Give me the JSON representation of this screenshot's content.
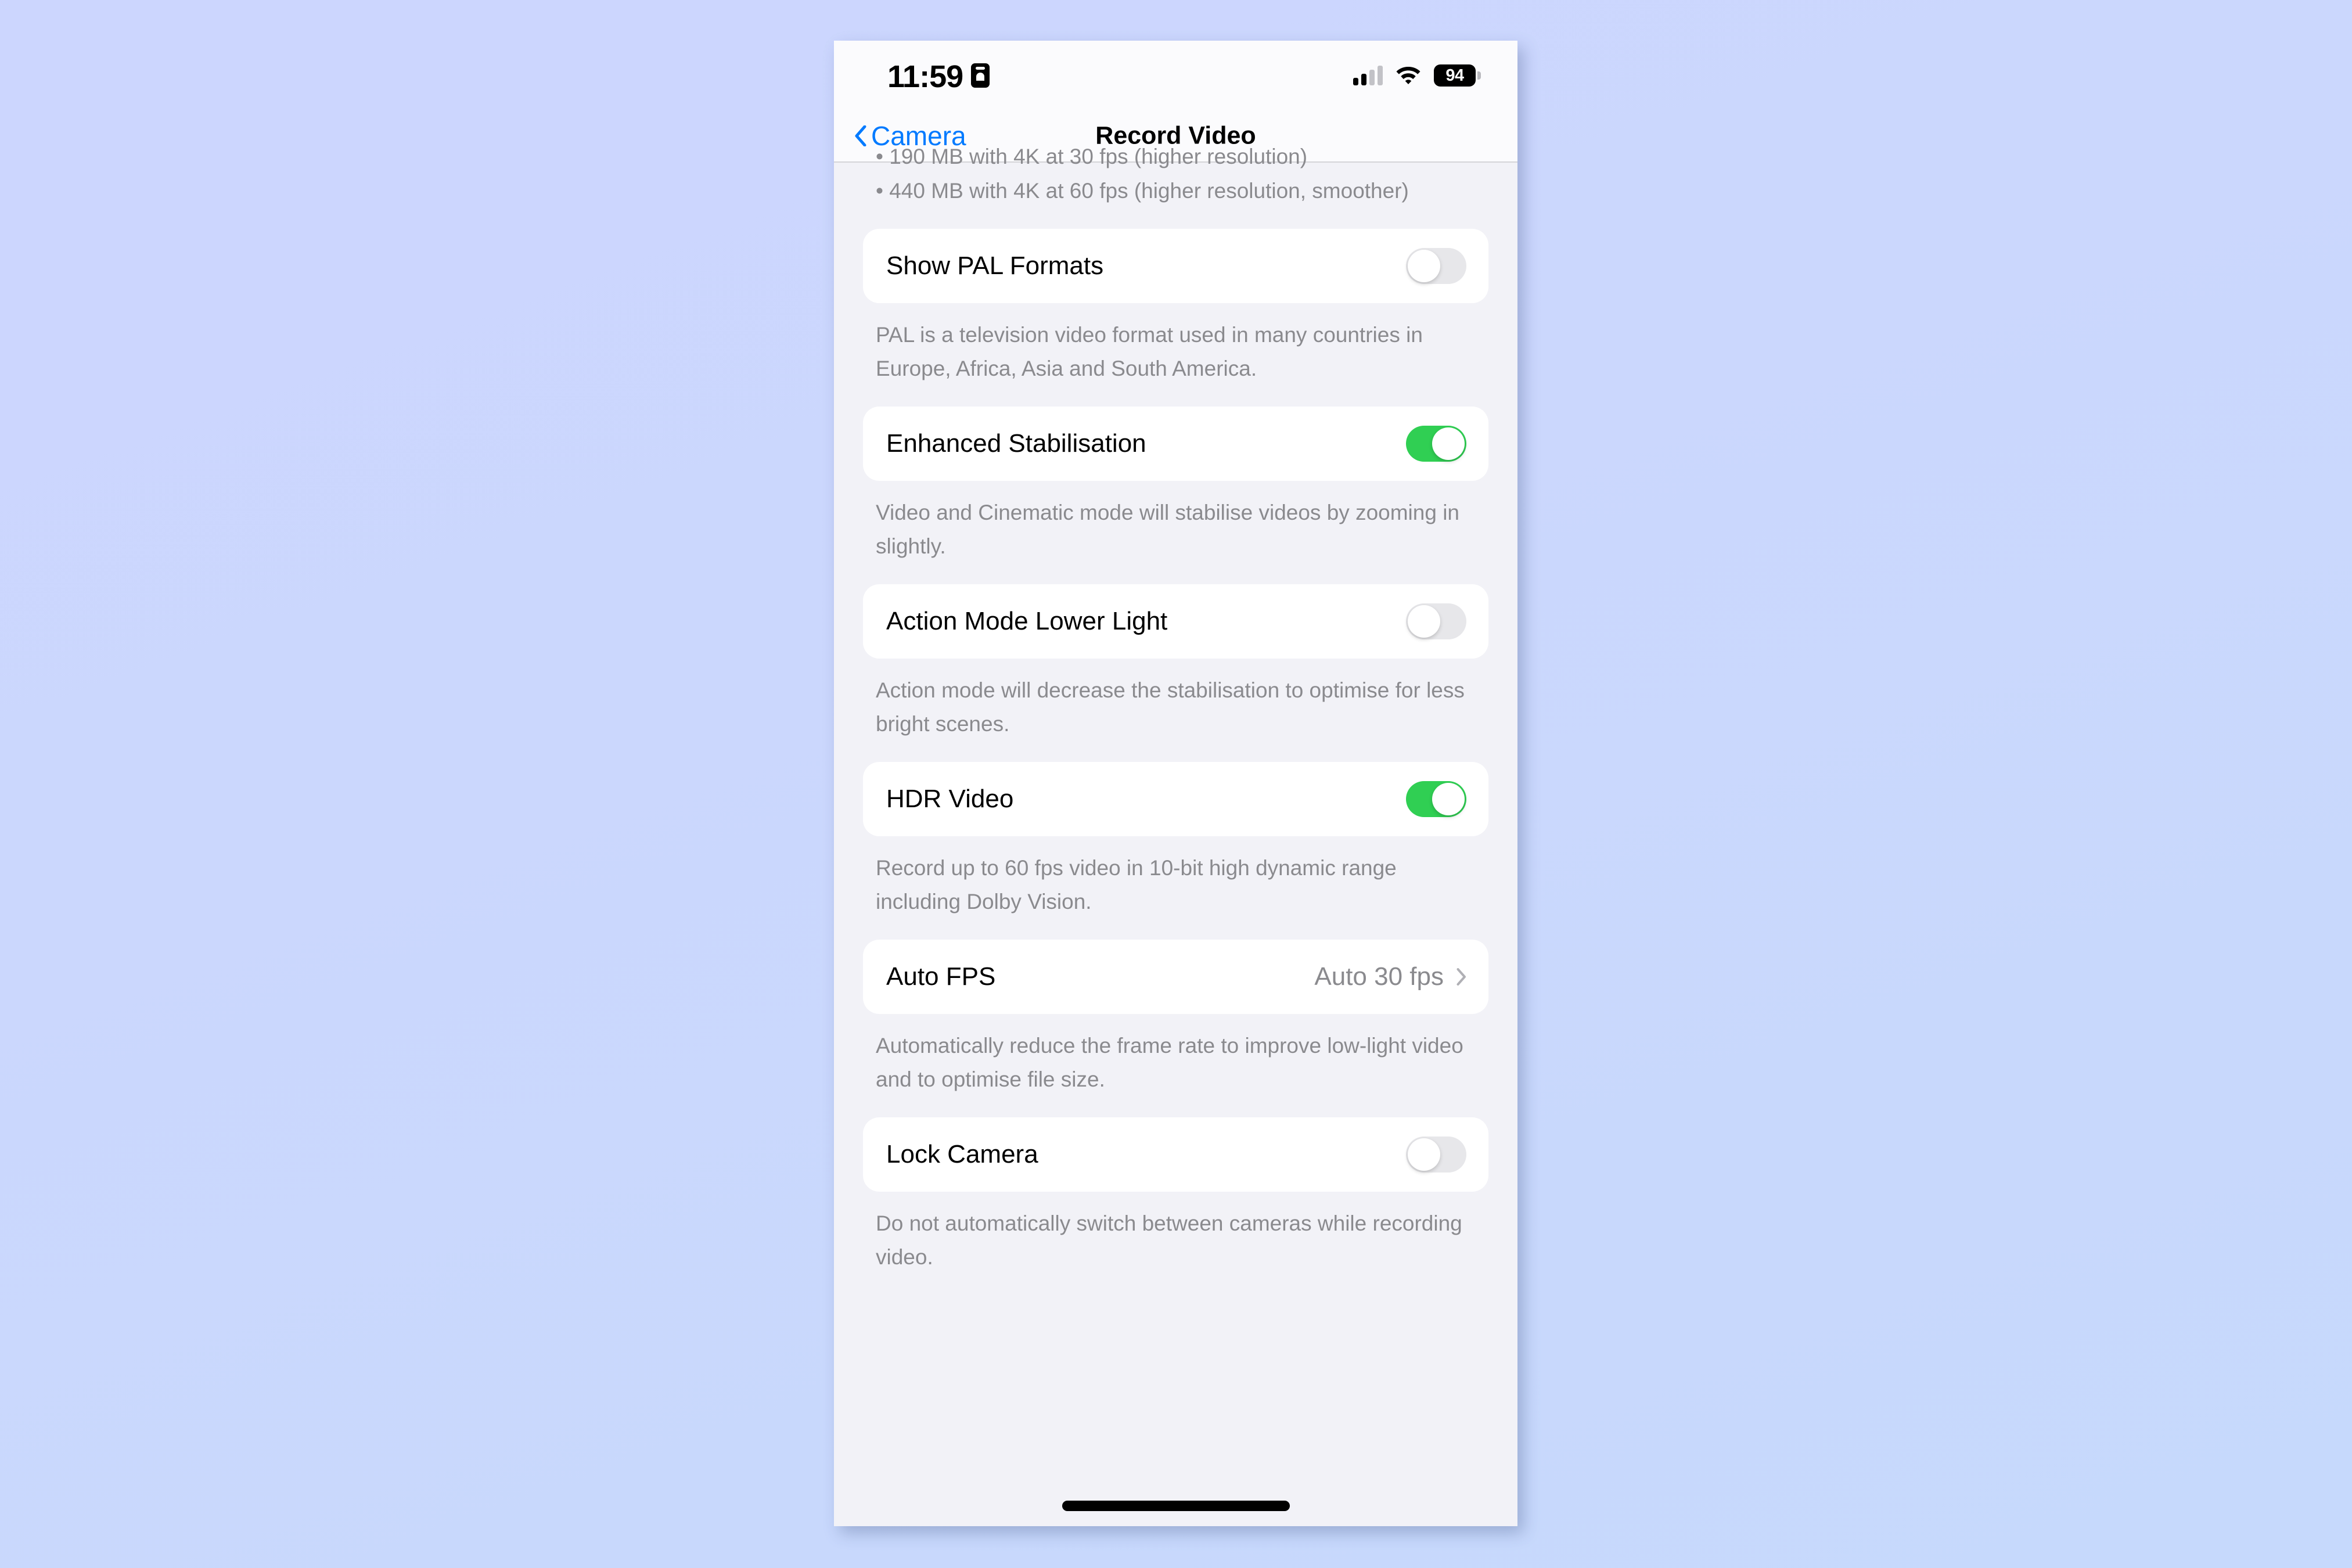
{
  "status_bar": {
    "time": "11:59",
    "contact_icon": "contact-card-icon",
    "signal_icon": "cellular-signal-icon",
    "wifi_icon": "wifi-icon",
    "battery_level": "94"
  },
  "nav": {
    "back_label": "Camera",
    "back_icon": "chevron-left-icon",
    "title": "Record Video"
  },
  "content": {
    "clipped_footnote_line1": "• 190 MB with 4K at 30 fps (higher resolution)",
    "clipped_footnote_line2": "• 440 MB with 4K at 60 fps (higher resolution, smoother)",
    "rows": [
      {
        "label": "Show PAL Formats",
        "control": "toggle",
        "state": "off",
        "description": "PAL is a television video format used in many countries in Europe, Africa, Asia and South America."
      },
      {
        "label": "Enhanced Stabilisation",
        "control": "toggle",
        "state": "on",
        "highlighted": true,
        "description": "Video and Cinematic mode will stabilise videos by zooming in slightly."
      },
      {
        "label": "Action Mode Lower Light",
        "control": "toggle",
        "state": "off",
        "description": "Action mode will decrease the stabilisation to optimise for less bright scenes."
      },
      {
        "label": "HDR Video",
        "control": "toggle",
        "state": "on",
        "description": "Record up to 60 fps video in 10-bit high dynamic range including Dolby Vision."
      },
      {
        "label": "Auto FPS",
        "control": "disclosure",
        "value": "Auto 30 fps",
        "description": "Automatically reduce the frame rate to improve low-light video and to optimise file size."
      },
      {
        "label": "Lock Camera",
        "control": "toggle",
        "state": "off",
        "description": "Do not automatically switch between cameras while recording video."
      }
    ]
  },
  "colors": {
    "accent_blue": "#007aff",
    "toggle_on_green": "#30cf53",
    "toggle_off_grey": "#e7e7ea",
    "annotation_green": "#00e619",
    "page_background": "#ccd6fe",
    "screen_background": "#f2f2f7"
  },
  "home_indicator": "home-indicator"
}
